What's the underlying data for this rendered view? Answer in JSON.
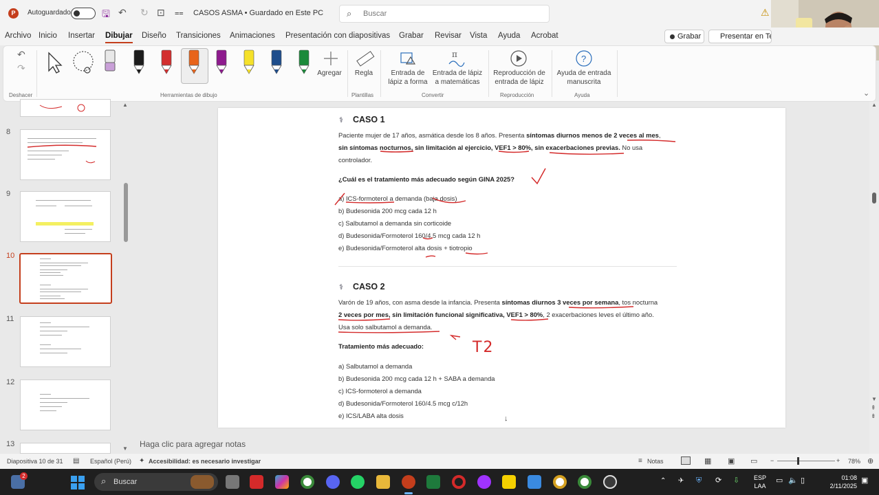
{
  "titlebar": {
    "autosave_label": "Autoguardado",
    "doc_title": "CASOS ASMA • Guardado en Este PC",
    "search_placeholder": "Buscar"
  },
  "menu": {
    "tabs": [
      "Archivo",
      "Inicio",
      "Insertar",
      "Dibujar",
      "Diseño",
      "Transiciones",
      "Animaciones",
      "Presentación con diapositivas",
      "Grabar",
      "Revisar",
      "Vista",
      "Ayuda",
      "Acrobat"
    ],
    "active_tab": "Dibujar",
    "record_label": "Grabar",
    "present_label": "Presentar en Te"
  },
  "ribbon": {
    "groups": {
      "undo": "Deshacer",
      "tools": "Herramientas de dibujo",
      "templates": "Plantillas",
      "convert": "Convertir",
      "playback": "Reproducción",
      "help": "Ayuda"
    },
    "add_label": "Agregar",
    "ruler_label": "Regla",
    "ink_to_shape": "Entrada de lápiz a forma",
    "ink_to_math": "Entrada de lápiz a matemáticas",
    "ink_replay": "Reproducción de entrada de lápiz",
    "ink_help": "Ayuda de entrada manuscrita",
    "pen_colors": [
      "#1c1c1c",
      "#d32f2f",
      "#e8641b",
      "#8e1b8e",
      "#f5e12a",
      "#1f4e8c",
      "#1b8a3a"
    ]
  },
  "thumbnails": [
    "8",
    "9",
    "10",
    "11",
    "12",
    "13"
  ],
  "active_slide": "10",
  "slide": {
    "caso1": {
      "title": "CASO 1",
      "para_line1_a": "Paciente mujer de 17 años, asmática desde los 8 años. Presenta ",
      "para_line1_b": "síntomas diurnos menos de 2 veces al mes",
      "para_line1_c": ",",
      "para_line2_a": "sin síntomas nocturnos, sin limitación al ejercicio, VEF1 > 80%, sin exacerbaciones previas.",
      "para_line2_b": " No usa",
      "para_line3": "controlador.",
      "question": "¿Cuál es el tratamiento más adecuado según GINA 2025?",
      "options": [
        "a) ICS-formoterol a demanda (baja dosis)",
        "b) Budesonida 200 mcg cada 12 h",
        "c) Salbutamol a demanda sin corticoide",
        "d) Budesonida/Formoterol 160/4.5 mcg cada 12 h",
        "e) Budesonida/Formoterol alta dosis + tiotropio"
      ]
    },
    "caso2": {
      "title": "CASO 2",
      "para_line1_a": "Varón de 19 años, con asma desde la infancia. Presenta ",
      "para_line1_b": "síntomas diurnos 3 veces por semana",
      "para_line1_c": ", tos nocturna",
      "para_line2_a": "2 veces por mes, sin limitación funcional significativa, VEF1 > 80%",
      "para_line2_b": ", 2 exacerbaciones leves el último año.",
      "para_line3": "Usa solo salbutamol a demanda.",
      "question": "Tratamiento más adecuado:",
      "annotation": "T2",
      "options": [
        "a) Salbutamol a demanda",
        "b) Budesonida 200 mcg cada 12 h + SABA a demanda",
        "c) ICS-formoterol a demanda",
        "d) Budesonida/Formoterol 160/4.5 mcg c/12h",
        "e) ICS/LABA alta dosis"
      ]
    }
  },
  "notes_placeholder": "Haga clic para agregar notas",
  "status": {
    "slide_count": "Diapositiva 10 de 31",
    "language": "Español (Perú)",
    "accessibility": "Accesibilidad: es necesario investigar",
    "notes": "Notas",
    "zoom": "78%"
  },
  "taskbar": {
    "search_placeholder": "Buscar",
    "lang_top": "ESP",
    "lang_bottom": "LAA",
    "time": "01:08",
    "date": "2/11/2025",
    "widget_badge": "2"
  }
}
